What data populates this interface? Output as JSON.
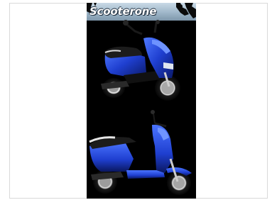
{
  "poster": {
    "brand": "Scooterone",
    "colors": {
      "background": "#000000",
      "body": "#1f3fd0",
      "seat": "#1c1c1c",
      "banner_top": "#c9d9e6",
      "banner_bottom": "#7e97ab"
    },
    "images": [
      {
        "name": "scooter-top-image"
      },
      {
        "name": "scooter-bottom-image"
      }
    ]
  }
}
